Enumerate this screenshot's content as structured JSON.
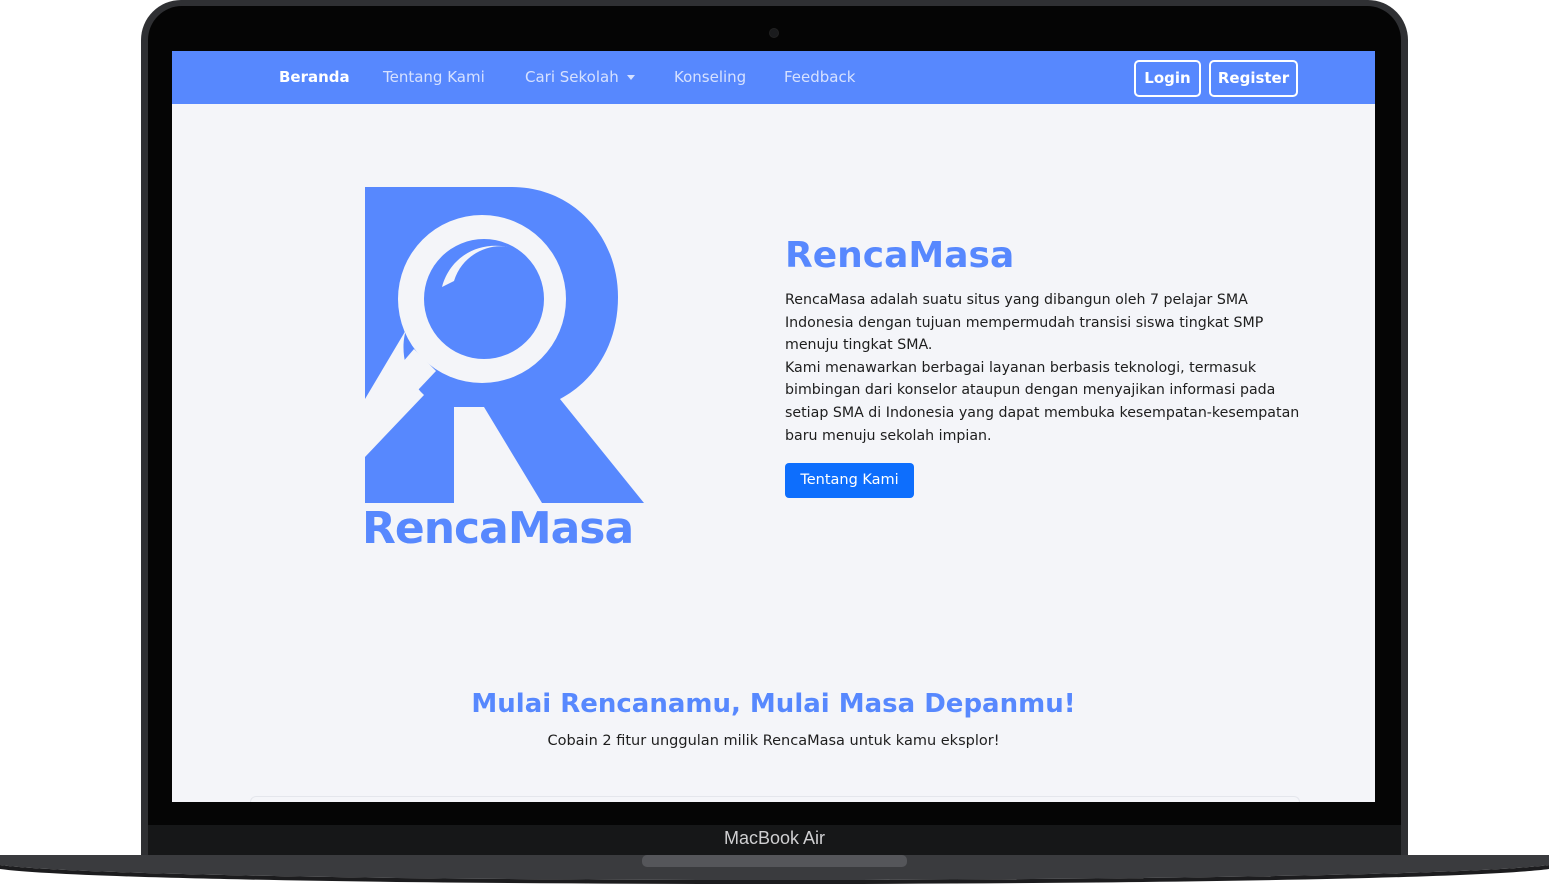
{
  "device": {
    "label": "MacBook Air"
  },
  "nav": {
    "items": [
      {
        "label": "Beranda",
        "active": true
      },
      {
        "label": "Tentang Kami",
        "active": false
      },
      {
        "label": "Cari Sekolah",
        "active": false,
        "dropdown": true
      },
      {
        "label": "Konseling",
        "active": false
      },
      {
        "label": "Feedback",
        "active": false
      }
    ],
    "login_label": "Login",
    "register_label": "Register"
  },
  "logo": {
    "text": "RencaMasa",
    "icon": "magnifier-letter-r-icon"
  },
  "hero": {
    "title": "RencaMasa",
    "paragraph1": "RencaMasa adalah suatu situs yang dibangun oleh 7 pelajar SMA Indonesia dengan tujuan mempermudah transisi siswa tingkat SMP menuju tingkat SMA.",
    "paragraph2": "Kami menawarkan berbagai layanan berbasis teknologi, termasuk bimbingan dari konselor ataupun dengan menyajikan informasi pada setiap SMA di Indonesia yang dapat membuka kesempatan-kesempatan baru menuju sekolah impian.",
    "button_label": "Tentang Kami"
  },
  "section": {
    "title": "Mulai Rencanamu, Mulai Masa Depanmu!",
    "subtitle": "Cobain 2 fitur unggulan milik RencaMasa untuk kamu eksplor!"
  },
  "colors": {
    "brand": "#5788fe",
    "primary_button": "#0d6efd",
    "page_background": "#f4f5f9",
    "nav_text_inactive": "#d6e1ff"
  }
}
